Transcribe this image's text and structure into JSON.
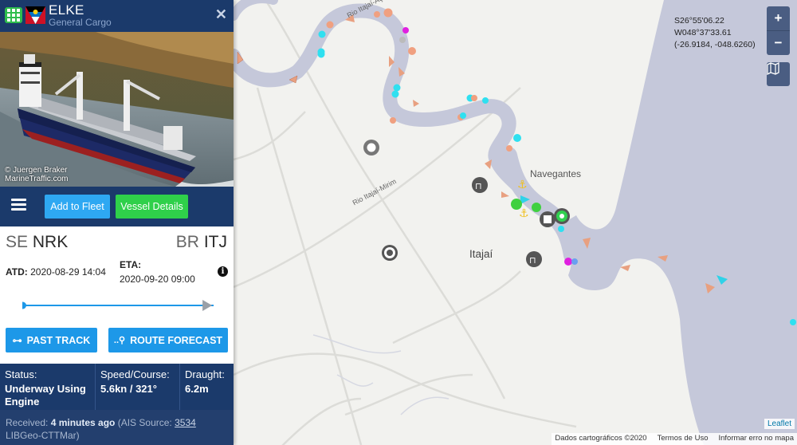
{
  "vessel": {
    "name": "ELKE",
    "type": "General Cargo",
    "photo_credit_line1": "© Juergen Braker",
    "photo_credit_line2": "MarineTraffic.com"
  },
  "actions": {
    "add_to_fleet": "Add to Fleet",
    "vessel_details": "Vessel Details"
  },
  "route": {
    "from_country": "SE",
    "from_port": "NRK",
    "to_country": "BR",
    "to_port": "ITJ",
    "atd_label": "ATD:",
    "atd_value": "2020-08-29 14:04",
    "eta_label": "ETA:",
    "eta_value": "2020-09-20 09:00",
    "progress": 0.95,
    "past_track": "PAST TRACK",
    "route_forecast": "ROUTE FORECAST"
  },
  "status": {
    "status_label": "Status:",
    "status_value": "Underway Using Engine",
    "speed_label": "Speed/Course:",
    "speed_value": "5.6kn / 321°",
    "draught_label": "Draught:",
    "draught_value": "6.2m"
  },
  "received": {
    "prefix": "Received: ",
    "age": "4 minutes ago",
    "source_prefix": " (AIS Source: ",
    "source_id": "3534",
    "source_name": "LIBGeo-CTTMar)"
  },
  "map": {
    "coord_dms_lat": "S26°55'06.22",
    "coord_dms_lon": "W048°37'33.61",
    "coord_decimal": "(-26.9184, -048.6260)",
    "zoom_in": "+",
    "zoom_out": "−",
    "place_navegantes": "Navegantes",
    "place_itajai": "Itajaí",
    "river_itajai_mirim": "Rio Itajaí-Mirim",
    "river_itajai_acu": "Rio Itajaí-Açu",
    "leaflet": "Leaflet",
    "attrib_data": "Dados cartográficos ©2020",
    "attrib_terms": "Termos de Uso",
    "attrib_report": "Informar erro no mapa",
    "colors": {
      "water": "#c5c8da",
      "land": "#f2f2ef",
      "panel_blue": "#1b3a6b"
    }
  }
}
